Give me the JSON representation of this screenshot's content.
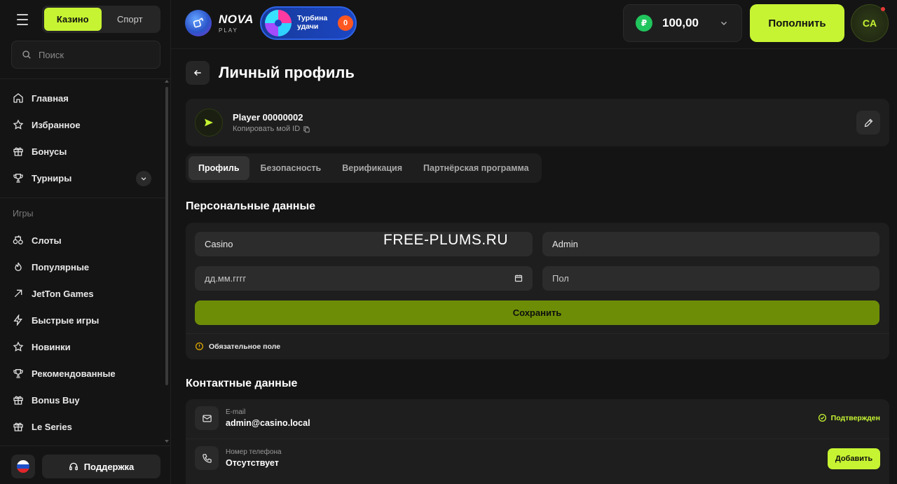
{
  "sidebar": {
    "mode_tabs": [
      {
        "label": "Казино",
        "active": true
      },
      {
        "label": "Спорт",
        "active": false
      }
    ],
    "search": {
      "placeholder": "Поиск"
    },
    "main_items": [
      {
        "label": "Главная",
        "icon": "home-icon"
      },
      {
        "label": "Избранное",
        "icon": "star-icon"
      },
      {
        "label": "Бонусы",
        "icon": "gift-icon"
      },
      {
        "label": "Турниры",
        "icon": "trophy-icon",
        "expandable": true
      }
    ],
    "games_heading": "Игры",
    "game_items": [
      {
        "label": "Слоты",
        "icon": "slots-icon"
      },
      {
        "label": "Популярные",
        "icon": "flame-icon"
      },
      {
        "label": "JetTon Games",
        "icon": "arrow-up-right-icon"
      },
      {
        "label": "Быстрые игры",
        "icon": "lightning-icon"
      },
      {
        "label": "Новинки",
        "icon": "star-icon"
      },
      {
        "label": "Рекомендованные",
        "icon": "trophy-icon"
      },
      {
        "label": "Bonus Buy",
        "icon": "gift-icon"
      },
      {
        "label": "Le Series",
        "icon": "gift-icon"
      }
    ],
    "support_label": "Поддержка",
    "language_flag": "ru"
  },
  "header": {
    "logo_name": "NOVA",
    "logo_sub": "PLAY",
    "turbina": {
      "label": "Турбина удачи",
      "count": "0"
    },
    "balance": {
      "value": "100,00",
      "currency_symbol": "₽"
    },
    "deposit_label": "Пополнить",
    "avatar_initials": "CA"
  },
  "page": {
    "title": "Личный профиль",
    "player_name": "Player 00000002",
    "copy_id_label": "Копировать мой ID",
    "tabs": [
      {
        "label": "Профиль",
        "active": true
      },
      {
        "label": "Безопасность",
        "active": false
      },
      {
        "label": "Верификация",
        "active": false
      },
      {
        "label": "Партнёрская программа",
        "active": false
      }
    ]
  },
  "personal": {
    "title": "Персональные данные",
    "first_name": "Casino",
    "last_name": "Admin",
    "birthdate_placeholder": "дд.мм.гггг",
    "gender_placeholder": "Пол",
    "save_label": "Сохранить",
    "required_note": "Обязательное поле",
    "watermark": "FREE-PLUMS.RU"
  },
  "contacts": {
    "title": "Контактные данные",
    "email": {
      "label": "E-mail",
      "value": "admin@casino.local",
      "status": "Подтвержден"
    },
    "phone": {
      "label": "Номер телефона",
      "value": "Отсутствует",
      "action": "Добавить"
    }
  },
  "colors": {
    "accent": "#c6f432",
    "save_button": "#6d8d07",
    "background": "#141414",
    "card": "#1e1e1e"
  }
}
